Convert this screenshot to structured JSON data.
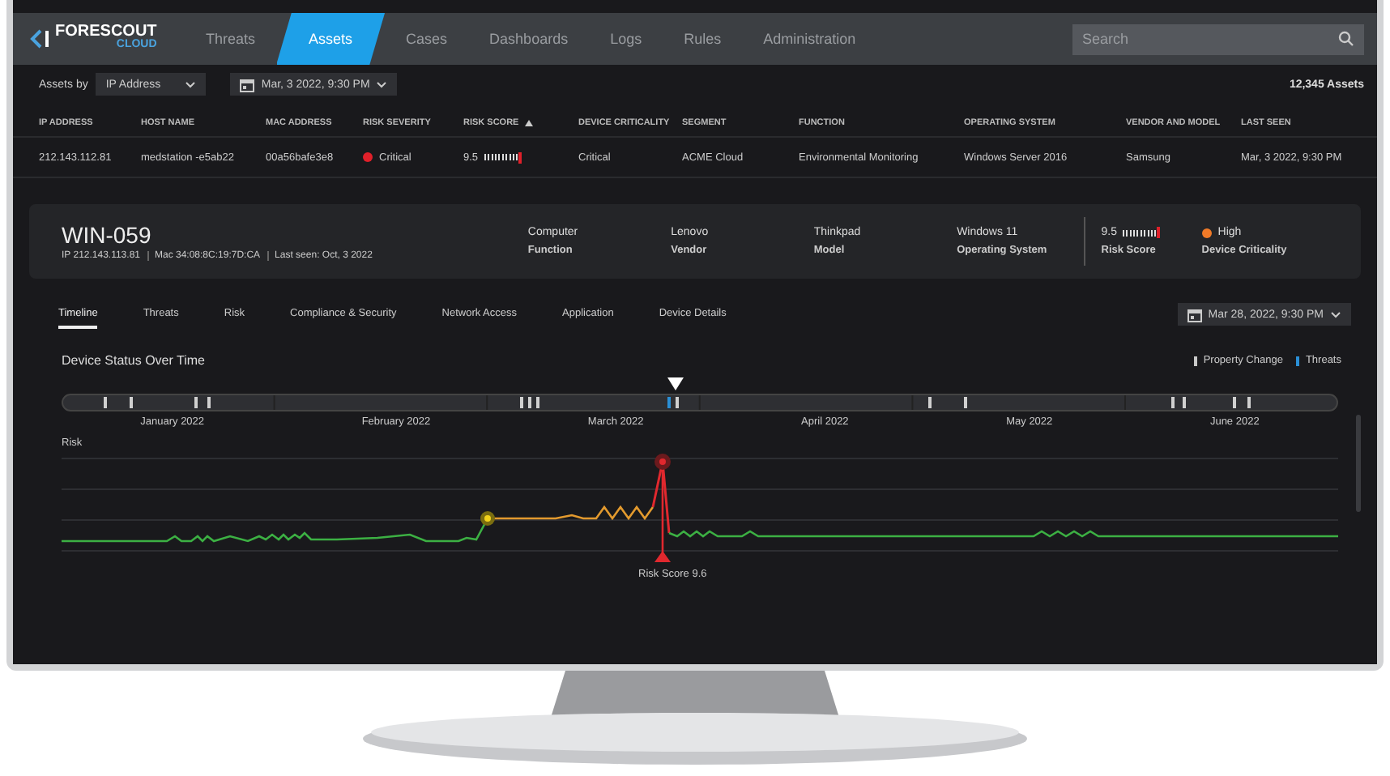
{
  "nav": {
    "logo": "FORESCOUT",
    "logo_sub": "CLOUD",
    "tabs": [
      {
        "label": "Threats",
        "selected": false
      },
      {
        "label": "Assets",
        "selected": true
      },
      {
        "label": "Cases",
        "selected": false
      },
      {
        "label": "Dashboards",
        "selected": false
      },
      {
        "label": "Logs",
        "selected": false
      },
      {
        "label": "Rules",
        "selected": false
      },
      {
        "label": "Administration",
        "selected": false
      }
    ],
    "search": {
      "placeholder": "Search"
    }
  },
  "filters": {
    "label": "Assets by",
    "group_by": "IP Address",
    "date": "Mar, 3 2022, 9:30 PM",
    "count": "12,345 Assets"
  },
  "table": {
    "columns": [
      {
        "label": "IP ADDRESS",
        "sorted": false
      },
      {
        "label": "HOST NAME",
        "sorted": false
      },
      {
        "label": "MAC ADDRESS",
        "sorted": false
      },
      {
        "label": "RISK SEVERITY",
        "sorted": false
      },
      {
        "label": "RISK SCORE",
        "sorted": true
      },
      {
        "label": "DEVICE CRITICALITY",
        "sorted": false
      },
      {
        "label": "SEGMENT",
        "sorted": false
      },
      {
        "label": "FUNCTION",
        "sorted": false
      },
      {
        "label": "OPERATING SYSTEM",
        "sorted": false
      },
      {
        "label": "VENDOR AND MODEL",
        "sorted": false
      },
      {
        "label": "LAST  SEEN",
        "sorted": false
      }
    ],
    "rows": [
      {
        "ip": "212.143.112.81",
        "host": "medstation -e5ab22",
        "mac": "00a56bafe3e8",
        "severity": {
          "label": "Critical",
          "color": "#e0202a"
        },
        "risk_score": {
          "value": "9.5",
          "level": 0.95
        },
        "criticality": "Critical",
        "segment": "ACME Cloud",
        "function": "Environmental Monitoring",
        "os": "Windows Server 2016",
        "vendor": "Samsung",
        "last_seen": "Mar, 3 2022, 9:30 PM"
      }
    ]
  },
  "device": {
    "name": "WIN-059",
    "meta": [
      "IP 212.143.113.81",
      "Mac 34:08:8C:19:7D:CA",
      "Last seen: Oct, 3 2022"
    ],
    "properties": [
      {
        "value": "Computer",
        "label": "Function"
      },
      {
        "value": "Lenovo",
        "label": "Vendor"
      },
      {
        "value": "Thinkpad",
        "label": "Model"
      },
      {
        "value": "Windows 11",
        "label": "Operating System"
      }
    ],
    "risk_score": {
      "value": "9.5",
      "level": 0.95,
      "label": "Risk Score"
    },
    "criticality": {
      "value": "High",
      "color": "#f07a28",
      "label": "Device Criticality"
    }
  },
  "subtabs": [
    {
      "label": "Timeline",
      "selected": true
    },
    {
      "label": "Threats",
      "selected": false
    },
    {
      "label": "Risk",
      "selected": false
    },
    {
      "label": "Compliance & Security",
      "selected": false
    },
    {
      "label": "Network Access",
      "selected": false
    },
    {
      "label": "Application",
      "selected": false
    },
    {
      "label": "Device Details",
      "selected": false
    }
  ],
  "date_picker": "Mar 28, 2022, 9:30 PM",
  "status": {
    "title": "Device Status Over Time",
    "legend": [
      {
        "label": "Property Change",
        "color": "#c8c8c8"
      },
      {
        "label": "Threats",
        "color": "#2a8fd6"
      }
    ],
    "months": [
      "January 2022",
      "February 2022",
      "March 2022",
      "April 2022",
      "May 2022",
      "June 2022"
    ],
    "risk_label": "Risk",
    "peak_label": "Risk Score 9.6"
  }
}
